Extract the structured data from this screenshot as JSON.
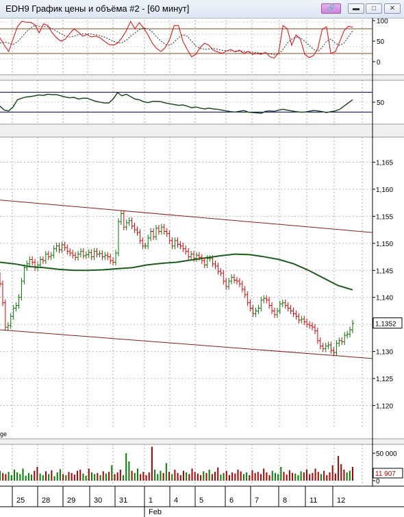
{
  "window": {
    "title": "EDH9 График цены и объёма #2 - [60 минут]"
  },
  "colors": {
    "up_bar": "#007700",
    "down_bar": "#dd0000",
    "ma": "#1a5c1a",
    "channel": "#8b1a1a",
    "stoch_k": "#ee0000",
    "stoch_d": "#2a2a2a",
    "oscillator": "#1a4a1a",
    "level_line": "#00008b",
    "vol_up": "#008000",
    "vol_down": "#aa0000"
  },
  "icons": {
    "link": "link-icon",
    "minimize": "minimize-icon",
    "maximize": "maximize-icon",
    "close": "close-icon"
  },
  "price_label_fragment": "ge",
  "stochastic": {
    "y_ticks": [
      "100",
      "50",
      "0"
    ],
    "levels": [
      80,
      20
    ],
    "k": [
      58,
      40,
      25,
      55,
      85,
      98,
      96,
      96,
      90,
      70,
      92,
      88,
      70,
      58,
      50,
      55,
      68,
      80,
      72,
      62,
      66,
      60,
      62,
      58,
      50,
      42,
      40,
      45,
      58,
      75,
      98,
      80,
      95,
      82,
      65,
      45,
      32,
      25,
      35,
      55,
      88,
      88,
      50,
      30,
      12,
      18,
      35,
      45,
      40,
      28,
      24,
      20,
      26,
      30,
      24,
      28,
      20,
      25,
      18,
      20,
      18,
      23,
      12,
      9,
      22,
      88,
      80,
      40,
      65,
      55,
      18,
      10,
      15,
      32,
      78,
      85,
      20,
      24,
      48,
      75,
      86,
      84
    ],
    "d": [
      45,
      48,
      45,
      42,
      48,
      60,
      72,
      82,
      88,
      86,
      85,
      85,
      80,
      74,
      68,
      62,
      60,
      62,
      66,
      68,
      68,
      67,
      65,
      63,
      60,
      55,
      50,
      46,
      46,
      52,
      62,
      70,
      78,
      82,
      80,
      72,
      60,
      50,
      42,
      40,
      48,
      58,
      66,
      62,
      50,
      38,
      32,
      30,
      31,
      32,
      30,
      28,
      27,
      26,
      26,
      26,
      25,
      24,
      23,
      22,
      21,
      20,
      19,
      17,
      18,
      30,
      45,
      55,
      60,
      58,
      50,
      40,
      30,
      25,
      35,
      50,
      55,
      45,
      40,
      45,
      60,
      75
    ]
  },
  "oscillator": {
    "y_ticks": [
      "50"
    ],
    "levels": [
      75,
      25
    ],
    "values": [
      40,
      30,
      28,
      38,
      56,
      60,
      63,
      64,
      66,
      68,
      67,
      70,
      69,
      69,
      66,
      63,
      61,
      62,
      58,
      60,
      60,
      56,
      52,
      50,
      48,
      48,
      58,
      74,
      66,
      70,
      64,
      58,
      56,
      51,
      49,
      52,
      52,
      51,
      48,
      46,
      44,
      42,
      43,
      40,
      36,
      38,
      35,
      33,
      35,
      33,
      32,
      30,
      28,
      26,
      25,
      27,
      29,
      25,
      24,
      23,
      22,
      27,
      28,
      27,
      30,
      32,
      30,
      28,
      26,
      25,
      25,
      27,
      29,
      28,
      26,
      24,
      26,
      28,
      32,
      40,
      48,
      56
    ]
  },
  "chart_data": {
    "type": "candlestick",
    "title": "EDH9 График цены и объёма #2 - [60 минут]",
    "timeframe": "60 минут",
    "ylim": [
      1.116,
      1.169
    ],
    "y_ticks": [
      "1,165",
      "1,160",
      "1,155",
      "1,150",
      "1,145",
      "1,140",
      "1,135",
      "1,130",
      "1,125",
      "1,120"
    ],
    "last_price_label": "1,1352",
    "x_labels": [
      "25",
      "28",
      "29",
      "30",
      "31",
      "1",
      "4",
      "5",
      "6",
      "7",
      "8",
      "11",
      "12"
    ],
    "month_label": "Feb",
    "close": [
      1.1425,
      1.139,
      1.1345,
      1.1348,
      1.1365,
      1.138,
      1.1385,
      1.14,
      1.143,
      1.1455,
      1.1462,
      1.147,
      1.1465,
      1.1455,
      1.146,
      1.147,
      1.1468,
      1.148,
      1.1475,
      1.1478,
      1.149,
      1.1495,
      1.1488,
      1.1497,
      1.1492,
      1.1485,
      1.1482,
      1.1478,
      1.1474,
      1.148,
      1.1485,
      1.1477,
      1.1479,
      1.1483,
      1.1475,
      1.1485,
      1.148,
      1.1481,
      1.1475,
      1.1478,
      1.1475,
      1.1468,
      1.1465,
      1.1482,
      1.154,
      1.1555,
      1.153,
      1.1538,
      1.1542,
      1.1532,
      1.1525,
      1.152,
      1.1505,
      1.1495,
      1.1495,
      1.151,
      1.1522,
      1.1512,
      1.1528,
      1.1522,
      1.153,
      1.1522,
      1.1518,
      1.1505,
      1.1495,
      1.1505,
      1.1498,
      1.1495,
      1.149,
      1.1485,
      1.1475,
      1.148,
      1.1472,
      1.1478,
      1.1474,
      1.1468,
      1.146,
      1.1472,
      1.1472,
      1.1462,
      1.1458,
      1.1448,
      1.1445,
      1.143,
      1.142,
      1.143,
      1.1437,
      1.1432,
      1.143,
      1.1425,
      1.1415,
      1.1405,
      1.139,
      1.138,
      1.137,
      1.1375,
      1.138,
      1.1395,
      1.1398,
      1.1395,
      1.1385,
      1.1375,
      1.1368,
      1.1375,
      1.1388,
      1.139,
      1.1385,
      1.138,
      1.1375,
      1.137,
      1.1365,
      1.1358,
      1.136,
      1.1355,
      1.135,
      1.1348,
      1.1345,
      1.1338,
      1.132,
      1.131,
      1.1305,
      1.131,
      1.1312,
      1.1302,
      1.1298,
      1.1315,
      1.132,
      1.1318,
      1.133,
      1.1332,
      1.134,
      1.1352
    ],
    "ma": [
      1.1465,
      1.1462,
      1.1457,
      1.1455,
      1.1452,
      1.145,
      1.145,
      1.1451,
      1.1453,
      1.1455,
      1.146,
      1.1463,
      1.1465,
      1.1469,
      1.1473,
      1.1477,
      1.148,
      1.1479,
      1.1475,
      1.147,
      1.1462,
      1.145,
      1.1436,
      1.1422,
      1.1414
    ],
    "channel_upper": [
      1.158,
      1.152
    ],
    "channel_lower": [
      1.134,
      1.1287
    ],
    "volume": {
      "y_ticks": [
        "50 000",
        "0"
      ],
      "last_volume_label": "11 907",
      "values": [
        18,
        14,
        12,
        16,
        10,
        20,
        15,
        12,
        22,
        9,
        14,
        11,
        18,
        25,
        13,
        10,
        17,
        12,
        19,
        8,
        15,
        21,
        12,
        10,
        16,
        14,
        11,
        18,
        20,
        13,
        9,
        22,
        15,
        12,
        14,
        10,
        17,
        13,
        16,
        28,
        12,
        15,
        20,
        10,
        50,
        35,
        18,
        14,
        22,
        12,
        16,
        10,
        15,
        62,
        20,
        12,
        18,
        14,
        32,
        16,
        12,
        20,
        14,
        10,
        18,
        15,
        12,
        22,
        16,
        13,
        10,
        17,
        14,
        20,
        12,
        16,
        24,
        11,
        14,
        18,
        10,
        15,
        13,
        20,
        17,
        12,
        15,
        10,
        19,
        14,
        16,
        12,
        22,
        15,
        10,
        18,
        14,
        12,
        25,
        16,
        11,
        19,
        14,
        13,
        10,
        17,
        15,
        20,
        12,
        14,
        22,
        16,
        12,
        18,
        10,
        15,
        28,
        13,
        45,
        30,
        20,
        15,
        18,
        25
      ]
    }
  }
}
